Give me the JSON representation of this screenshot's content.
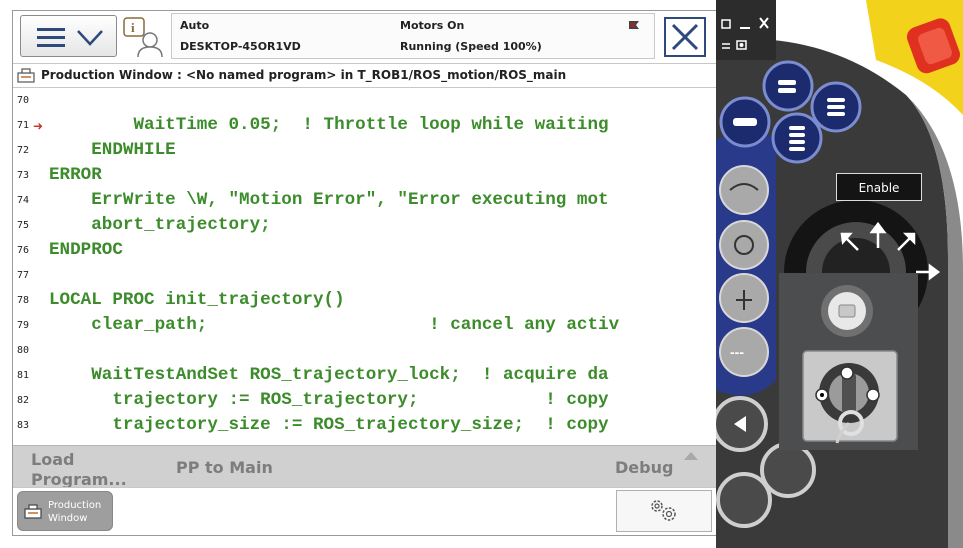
{
  "header": {
    "mode": "Auto",
    "controller": "DESKTOP-45OR1VD",
    "motors": "Motors On",
    "run_state": "Running (Speed 100%)"
  },
  "window": {
    "title": "Production Window : <No named program> in T_ROB1/ROS_motion/ROS_main"
  },
  "code": {
    "lines": [
      {
        "n": "70",
        "t": ""
      },
      {
        "n": "71",
        "t": "        WaitTime 0.05;  ! Throttle loop while waiting"
      },
      {
        "n": "72",
        "t": "    ENDWHILE"
      },
      {
        "n": "73",
        "t": "ERROR"
      },
      {
        "n": "74",
        "t": "    ErrWrite \\W, \"Motion Error\", \"Error executing mot"
      },
      {
        "n": "75",
        "t": "    abort_trajectory;"
      },
      {
        "n": "76",
        "t": "ENDPROC"
      },
      {
        "n": "77",
        "t": ""
      },
      {
        "n": "78",
        "t": "LOCAL PROC init_trajectory()"
      },
      {
        "n": "79",
        "t": "    clear_path;                     ! cancel any activ"
      },
      {
        "n": "80",
        "t": ""
      },
      {
        "n": "81",
        "t": "    WaitTestAndSet ROS_trajectory_lock;  ! acquire da"
      },
      {
        "n": "82",
        "t": "      trajectory := ROS_trajectory;            ! copy"
      },
      {
        "n": "83",
        "t": "      trajectory_size := ROS_trajectory_size;  ! copy"
      }
    ],
    "pp_line": "71"
  },
  "toolbar": {
    "load_program_1": "Load",
    "load_program_2": "Program...",
    "pp_to_main": "PP to Main",
    "debug": "Debug"
  },
  "taskbar": {
    "production_window_1": "Production",
    "production_window_2": "Window"
  },
  "flexpendant": {
    "enable_label": "Enable"
  },
  "colors": {
    "code_green": "#3c8c2c",
    "pendant_blue": "#1c2a6e",
    "pendant_yellow": "#f2d21a",
    "estop_red": "#e03020"
  }
}
